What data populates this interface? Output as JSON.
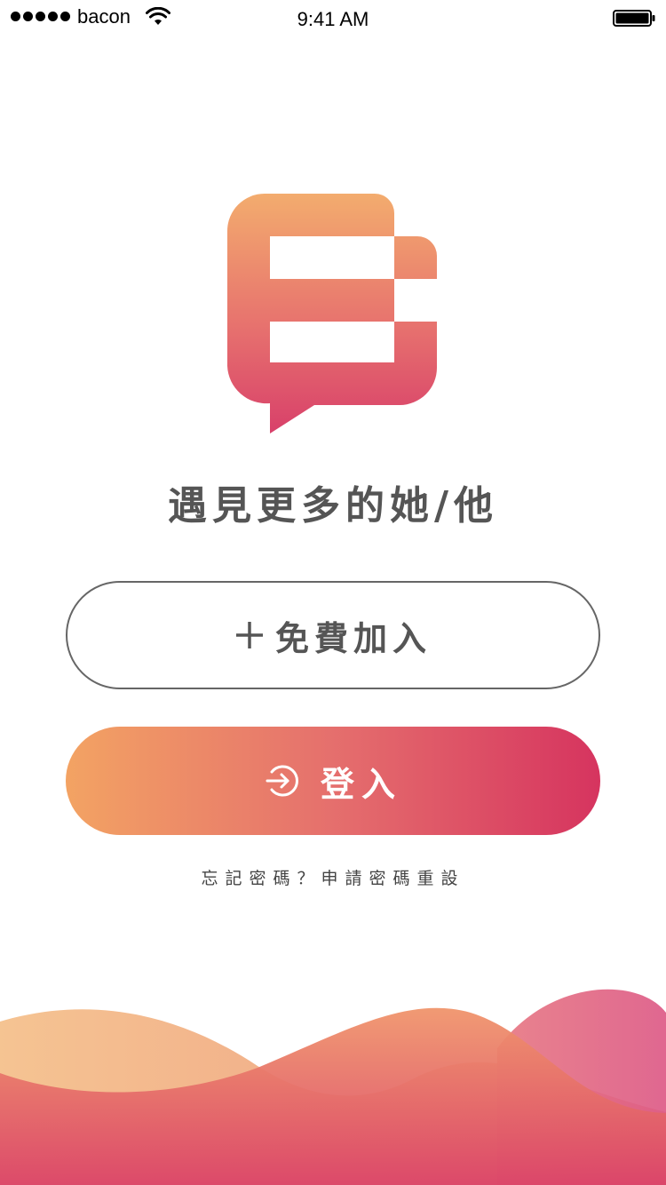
{
  "status_bar": {
    "carrier": "bacon",
    "time": "9:41 AM",
    "signal_bars": 5,
    "icons": [
      "signal-dots",
      "wifi-icon",
      "battery-icon"
    ]
  },
  "app": {
    "logo": "chat-bubble-logo",
    "tagline": "遇見更多的她/他",
    "colors": {
      "gradient_start": "#f3a363",
      "gradient_mid": "#e56f6d",
      "gradient_end": "#d6345f",
      "text_gray": "#555555"
    }
  },
  "actions": {
    "join": {
      "icon": "plus-icon",
      "label": "免費加入"
    },
    "login": {
      "icon": "login-icon",
      "label": "登入"
    },
    "forgot_password": "忘記密碼？申請密碼重設"
  }
}
